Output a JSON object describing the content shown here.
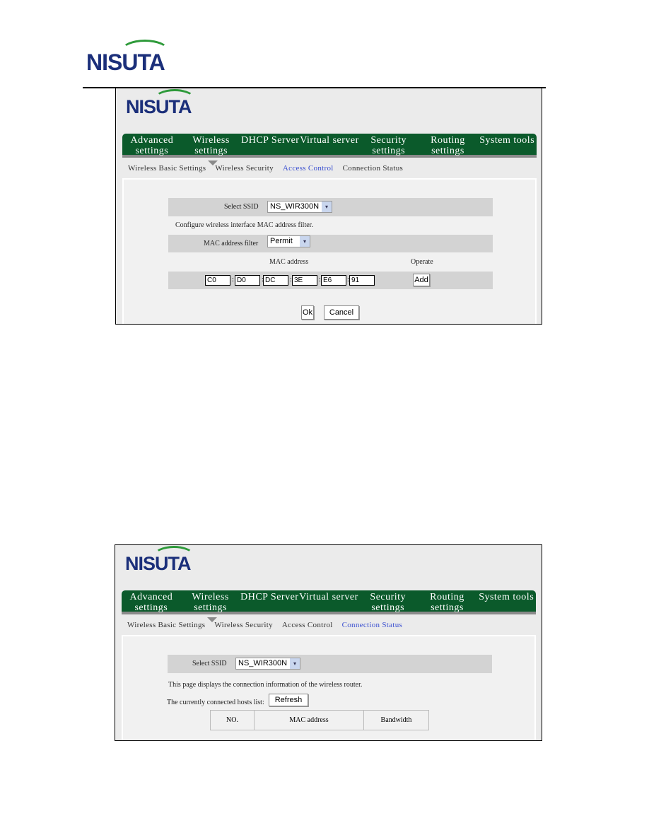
{
  "document": {
    "header_logo": "NISUTA"
  },
  "screens": [
    {
      "logo": "NISUTA",
      "nav": [
        "Advanced settings",
        "Wireless settings",
        "DHCP Server",
        "Virtual server",
        "Security settings",
        "Routing settings",
        "System tools"
      ],
      "subnav": [
        "Wireless Basic Settings",
        "Wireless Security",
        "Access Control",
        "Connection Status"
      ],
      "active_subnav": "Access Control",
      "select_ssid_label": "Select SSID",
      "ssid_value": "NS_WIR300N",
      "description": "Configure wireless interface MAC address filter.",
      "filter_label": "MAC address filter",
      "filter_value": "Permit",
      "mac_header": "MAC address",
      "operate_header": "Operate",
      "mac_octets": [
        "C0",
        "D0",
        "DC",
        "3E",
        "E6",
        "91"
      ],
      "add_label": "Add",
      "ok_label": "Ok",
      "cancel_label": "Cancel"
    },
    {
      "logo": "NISUTA",
      "nav": [
        "Advanced settings",
        "Wireless settings",
        "DHCP Server",
        "Virtual server",
        "Security settings",
        "Routing settings",
        "System tools"
      ],
      "subnav": [
        "Wireless Basic Settings",
        "Wireless Security",
        "Access Control",
        "Connection Status"
      ],
      "active_subnav": "Connection Status",
      "select_ssid_label": "Select SSID",
      "ssid_value": "NS_WIR300N",
      "description": "This page displays the connection information of the wireless router.",
      "hosts_label": "The currently connected hosts list:",
      "refresh_label": "Refresh",
      "table_headers": [
        "NO.",
        "MAC address",
        "Bandwidth"
      ]
    }
  ],
  "colors": {
    "nav": "#0b5a2b",
    "active_link": "#3a4fd0",
    "logo_blue": "#1b2f7a",
    "logo_green": "#2e9a3a"
  }
}
